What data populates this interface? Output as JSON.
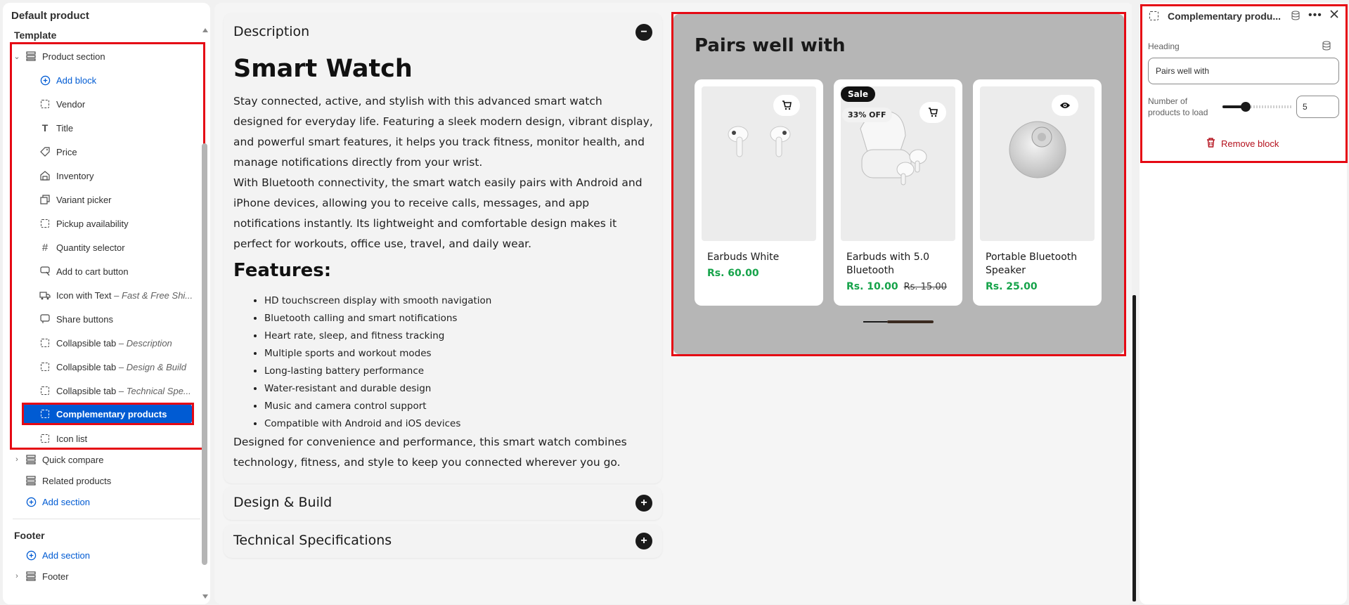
{
  "sidebar": {
    "title": "Default product",
    "template_label": "Template",
    "items": [
      {
        "label": "Product section",
        "suffix": "",
        "icon": "section-icon"
      },
      {
        "label": "Add block",
        "suffix": "",
        "icon": "plus-circle-icon"
      },
      {
        "label": "Vendor",
        "suffix": "",
        "icon": "dashed-box-icon"
      },
      {
        "label": "Title",
        "suffix": "",
        "icon": "text-icon"
      },
      {
        "label": "Price",
        "suffix": "",
        "icon": "price-tag-icon"
      },
      {
        "label": "Inventory",
        "suffix": "",
        "icon": "inventory-icon"
      },
      {
        "label": "Variant picker",
        "suffix": "",
        "icon": "variant-icon"
      },
      {
        "label": "Pickup availability",
        "suffix": "",
        "icon": "dashed-box-icon"
      },
      {
        "label": "Quantity selector",
        "suffix": "",
        "icon": "hash-icon"
      },
      {
        "label": "Add to cart button",
        "suffix": "",
        "icon": "cart-button-icon"
      },
      {
        "label": "Icon with Text",
        "suffix": "Fast & Free Shi...",
        "icon": "truck-icon"
      },
      {
        "label": "Share buttons",
        "suffix": "",
        "icon": "share-icon"
      },
      {
        "label": "Collapsible tab",
        "suffix": "Description",
        "icon": "dashed-box-icon"
      },
      {
        "label": "Collapsible tab",
        "suffix": "Design & Build",
        "icon": "dashed-box-icon"
      },
      {
        "label": "Collapsible tab",
        "suffix": "Technical Spe...",
        "icon": "dashed-box-icon"
      },
      {
        "label": "Complementary products",
        "suffix": "",
        "icon": "dashed-box-icon"
      },
      {
        "label": "Icon list",
        "suffix": "",
        "icon": "dashed-box-icon"
      }
    ],
    "suffix_separator": " – ",
    "quick_compare": "Quick compare",
    "related_products": "Related products",
    "add_section": "Add section",
    "footer_group": "Footer",
    "footer_add_section": "Add section",
    "footer_item": "Footer"
  },
  "preview": {
    "description_tab": "Description",
    "product_title": "Smart Watch",
    "paragraph_1": "Stay connected, active, and stylish with this advanced smart watch designed for everyday life. Featuring a sleek modern design, vibrant display, and powerful smart features, it helps you track fitness, monitor health, and manage notifications directly from your wrist.",
    "paragraph_2": "With Bluetooth connectivity, the smart watch easily pairs with Android and iPhone devices, allowing you to receive calls, messages, and app notifications instantly. Its lightweight and comfortable design makes it perfect for workouts, office use, travel, and daily wear.",
    "features_heading": "Features:",
    "features": [
      "HD touchscreen display with smooth navigation",
      "Bluetooth calling and smart notifications",
      "Heart rate, sleep, and fitness tracking",
      "Multiple sports and workout modes",
      "Long-lasting battery performance",
      "Water-resistant and durable design",
      "Music and camera control support",
      "Compatible with Android and iOS devices"
    ],
    "closing": "Designed for convenience and performance, this smart watch combines technology, fitness, and style to keep you connected wherever you go.",
    "design_tab": "Design & Build",
    "tech_tab": "Technical Specifications",
    "pairs_heading": "Pairs well with",
    "products": [
      {
        "name": "Earbuds White",
        "price": "Rs. 60.00",
        "compare": "",
        "sale": "",
        "off": "",
        "action_icon": "cart-icon"
      },
      {
        "name": "Earbuds with 5.0 Bluetooth",
        "price": "Rs. 10.00",
        "compare": "Rs. 15.00",
        "sale": "Sale",
        "off": "33% OFF",
        "action_icon": "cart-icon"
      },
      {
        "name": "Portable Bluetooth Speaker",
        "price": "Rs. 25.00",
        "compare": "",
        "sale": "",
        "off": "",
        "action_icon": "eye-icon"
      }
    ]
  },
  "settings": {
    "title": "Complementary produ...",
    "heading_label": "Heading",
    "heading_value": "Pairs well with",
    "products_label": "Number of products to load",
    "products_value": "5",
    "slider_fraction": 0.33,
    "remove_label": "Remove block"
  },
  "colors": {
    "accent": "#005bd3",
    "highlight": "#e50914",
    "price_green": "#16a34a",
    "danger": "#b4101c"
  }
}
